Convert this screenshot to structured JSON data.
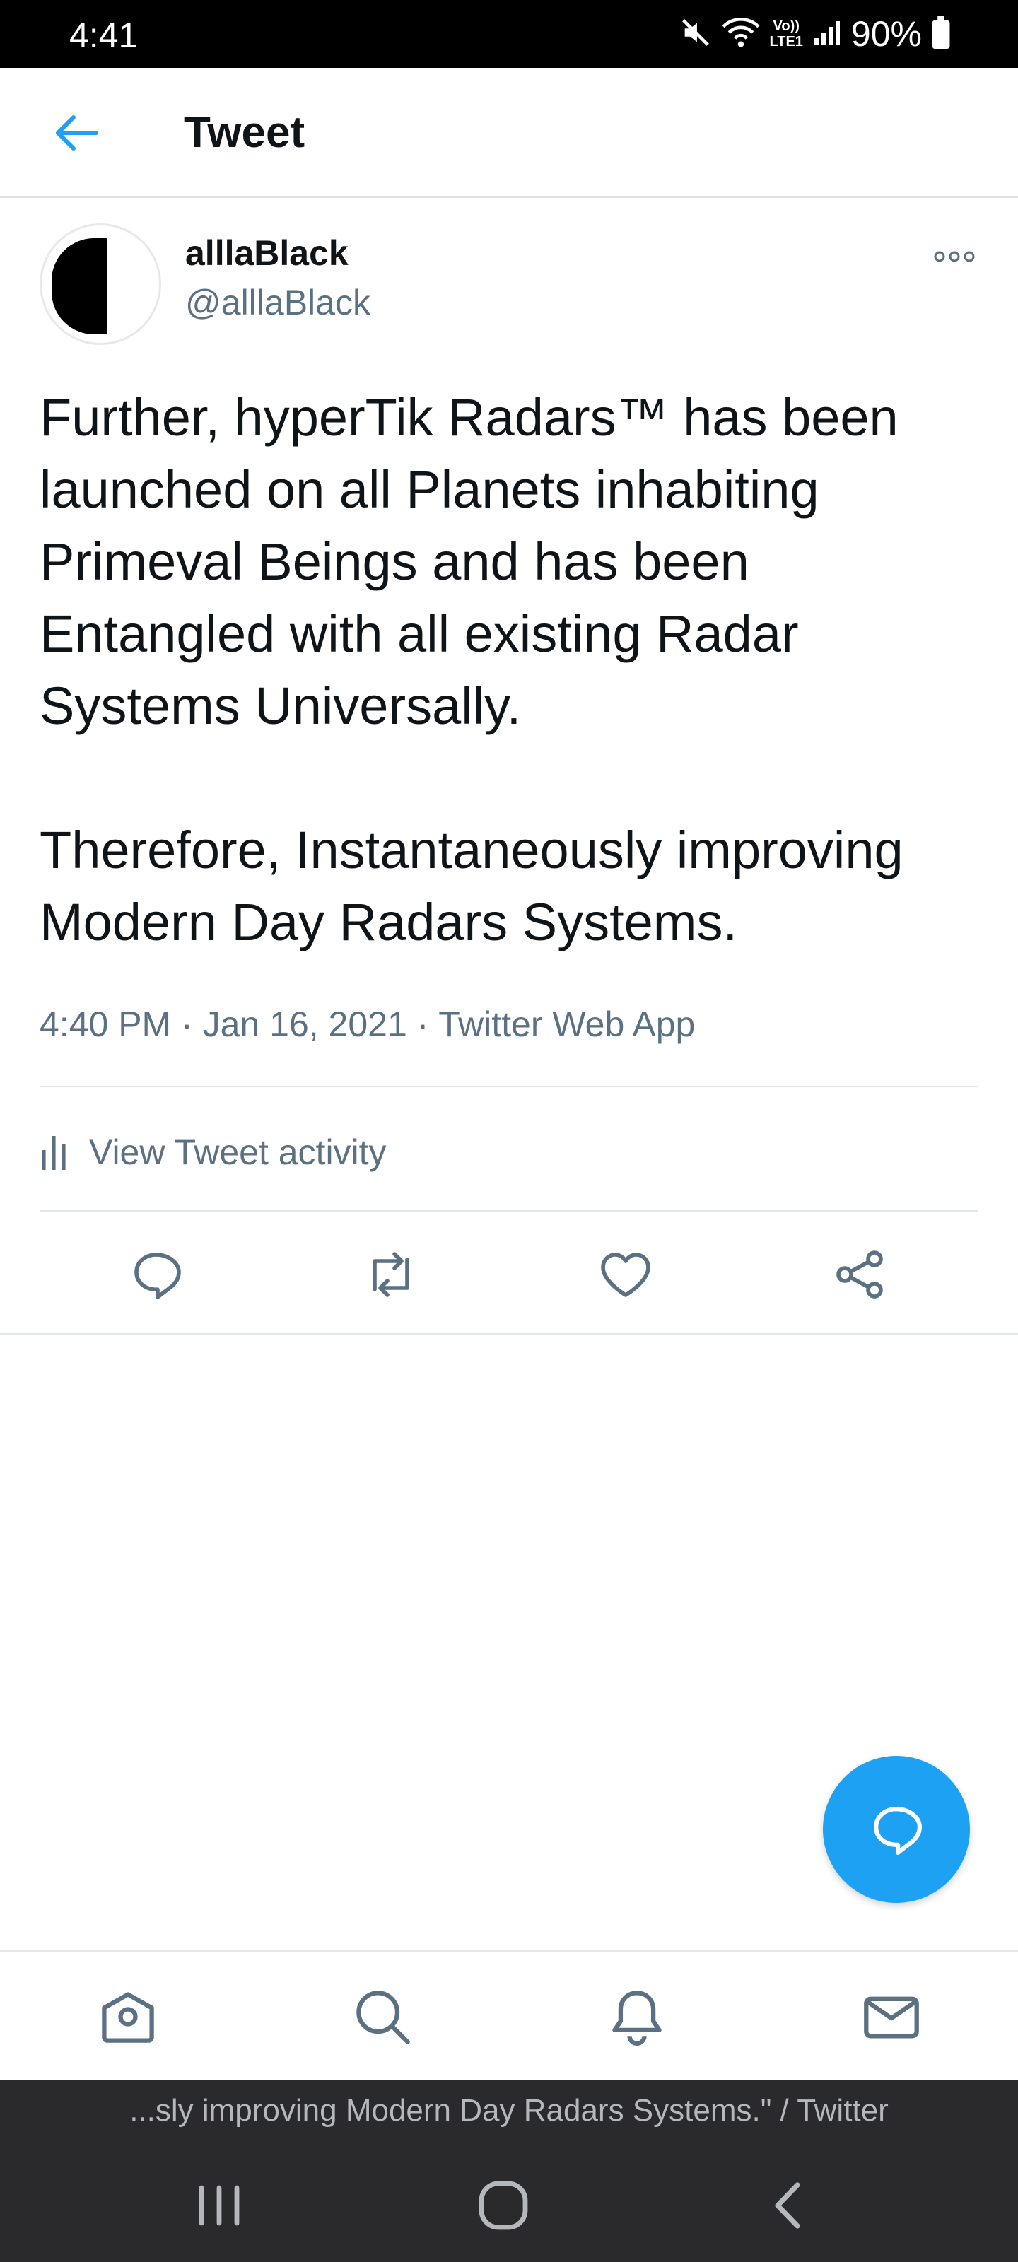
{
  "status_bar": {
    "time": "4:41",
    "lte_top": "Vo))",
    "lte_bottom": "LTE1",
    "battery": "90%"
  },
  "header": {
    "title": "Tweet",
    "back_icon": "arrow-left-icon"
  },
  "tweet": {
    "display_name": "alllaBlack",
    "handle": "@alllaBlack",
    "text": "Further, hyperTik Radars™ has been\nlaunched on all Planets inhabiting\nPrimeval Beings and has been\nEntangled with all existing Radar\nSystems Universally.\n\nTherefore, Instantaneously improving\nModern Day Radars Systems.",
    "time": "4:40 PM",
    "date": "Jan 16, 2021",
    "source": "Twitter Web App",
    "separator": " · "
  },
  "activity": {
    "label": "View Tweet activity"
  },
  "actions": [
    "reply-icon",
    "retweet-icon",
    "like-icon",
    "share-icon"
  ],
  "bottom_nav": [
    "home-icon",
    "search-icon",
    "notifications-icon",
    "messages-icon"
  ],
  "page_caption": "...sly improving Modern Day Radars Systems.\" / Twitter",
  "colors": {
    "accent": "#1da1f2",
    "secondary_text": "#5b7083",
    "primary_text": "#0f1419"
  }
}
